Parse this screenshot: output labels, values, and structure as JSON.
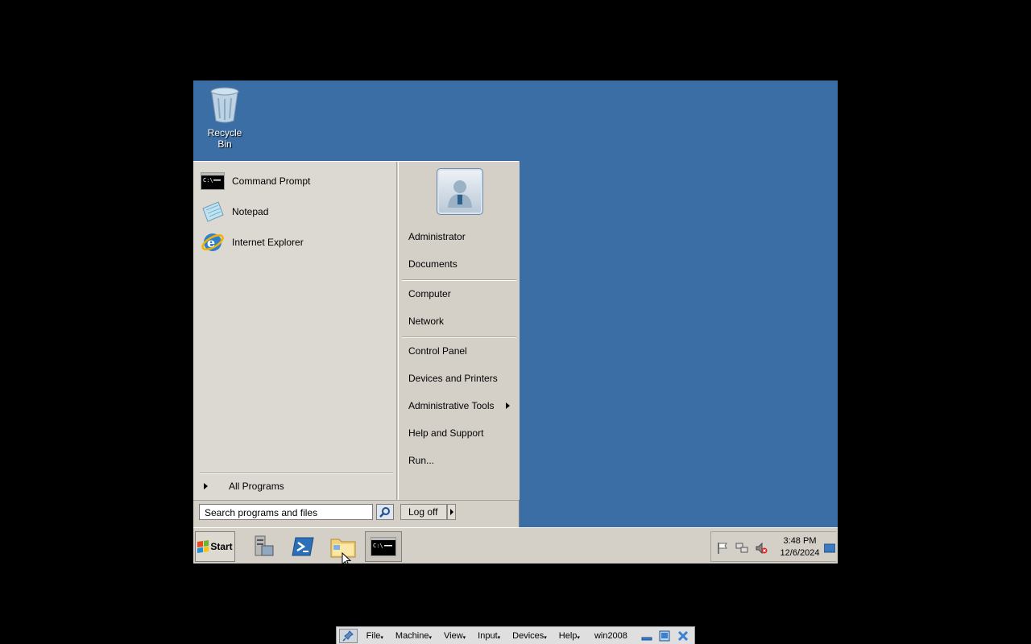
{
  "desktop": {
    "recycle_bin_label": "Recycle Bin"
  },
  "start_menu": {
    "pinned": [
      {
        "label": "Command Prompt",
        "icon": "command-prompt-icon"
      },
      {
        "label": "Notepad",
        "icon": "notepad-icon"
      },
      {
        "label": "Internet Explorer",
        "icon": "internet-explorer-icon"
      }
    ],
    "all_programs": "All Programs",
    "search_placeholder": "Search programs and files",
    "right": {
      "user": "Administrator",
      "documents": "Documents",
      "computer": "Computer",
      "network": "Network",
      "control_panel": "Control Panel",
      "devices_printers": "Devices and Printers",
      "admin_tools": "Administrative Tools",
      "help_support": "Help and Support",
      "run": "Run..."
    },
    "log_off": "Log off"
  },
  "taskbar": {
    "start": "Start",
    "buttons": [
      "server-manager-icon",
      "powershell-icon",
      "explorer-folder-icon",
      "command-prompt-icon"
    ],
    "clock_time": "3:48 PM",
    "clock_date": "12/6/2024"
  },
  "vbox_toolbar": {
    "menus": [
      "File",
      "Machine",
      "View",
      "Input",
      "Devices",
      "Help"
    ],
    "vm_name": "win2008"
  },
  "colors": {
    "desktop": "#3b6ea5",
    "menu_bg": "#d4d0c8"
  }
}
